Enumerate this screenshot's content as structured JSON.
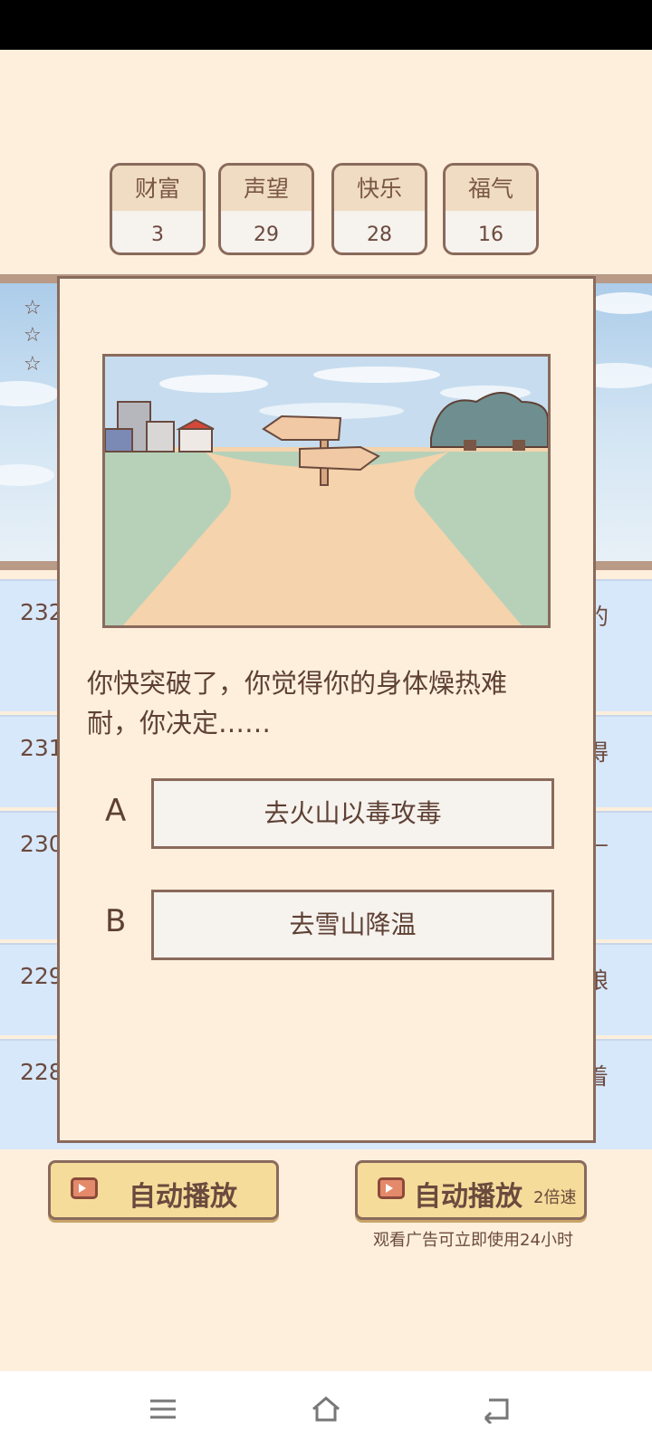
{
  "stats": [
    {
      "label": "财富",
      "value": "3"
    },
    {
      "label": "声望",
      "value": "29"
    },
    {
      "label": "快乐",
      "value": "28"
    },
    {
      "label": "福气",
      "value": "16"
    }
  ],
  "history_rows": [
    {
      "num": "232",
      "tail": "的"
    },
    {
      "num": "231",
      "tail": "得"
    },
    {
      "num": "230",
      "tail": "—"
    },
    {
      "num": "229",
      "tail": "娘"
    },
    {
      "num": "228",
      "tail": "着"
    }
  ],
  "modal": {
    "question": "你快突破了，你觉得你的身体燥热难耐，你决定……",
    "options": [
      {
        "letter": "A",
        "text": "去火山以毒攻毒"
      },
      {
        "letter": "B",
        "text": "去雪山降温"
      }
    ]
  },
  "bottom": {
    "auto_play": "自动播放",
    "auto_play_fast": "自动播放",
    "speed": "2倍速",
    "ad_note": "观看广告可立即使用24小时"
  },
  "colors": {
    "background": "#fdefdc",
    "border": "#8a6a5c",
    "button_yellow": "#f5dc9a",
    "list_blue": "#d8e8fb"
  }
}
